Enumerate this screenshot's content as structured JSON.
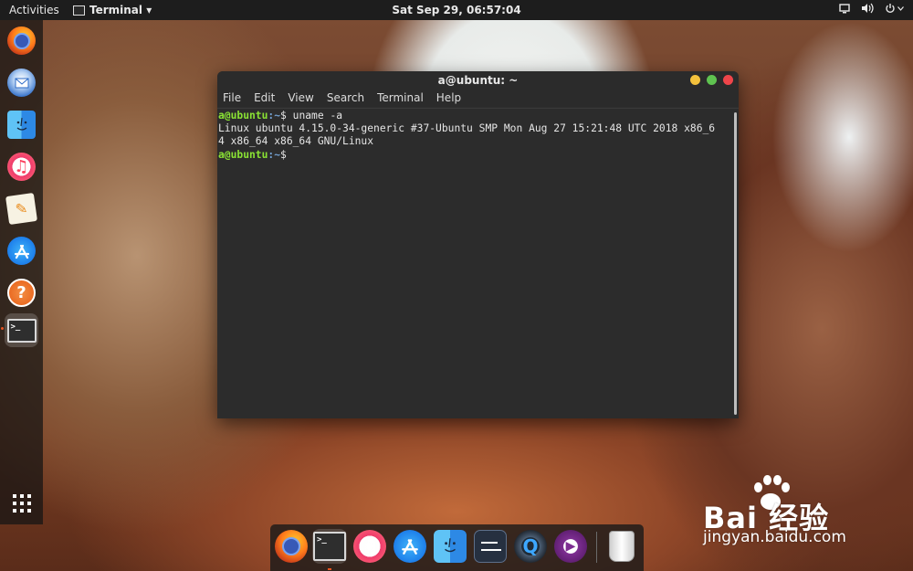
{
  "topbar": {
    "activities": "Activities",
    "app_menu": "Terminal ▾",
    "clock": "Sat Sep 29, 06:57:04",
    "tray": [
      "screen-icon",
      "volume-icon",
      "power-icon"
    ]
  },
  "dock": {
    "items": [
      {
        "name": "firefox-icon"
      },
      {
        "name": "thunderbird-icon"
      },
      {
        "name": "finder-icon"
      },
      {
        "name": "itunes-icon"
      },
      {
        "name": "pages-icon"
      },
      {
        "name": "app-store-icon"
      },
      {
        "name": "help-icon"
      },
      {
        "name": "terminal-icon",
        "active": true
      },
      {
        "name": "show-applications-icon"
      }
    ]
  },
  "window": {
    "title": "a@ubuntu: ~",
    "menu": [
      "File",
      "Edit",
      "View",
      "Search",
      "Terminal",
      "Help"
    ],
    "terminal": {
      "prompt_user": "a@ubuntu",
      "prompt_path": ":~",
      "prompt_symbol": "$",
      "command": " uname -a",
      "output_line1": "Linux ubuntu 4.15.0-34-generic #37-Ubuntu SMP Mon Aug 27 15:21:48 UTC 2018 x86_6",
      "output_line2": "4 x86_64 x86_64 GNU/Linux"
    }
  },
  "bottom_dock": {
    "items": [
      "firefox-icon",
      "terminal-icon",
      "itunes-icon",
      "app-store-icon",
      "finder-icon",
      "settings-icon",
      "quicktime-icon",
      "media-player-icon",
      "trash-icon"
    ]
  },
  "watermark": {
    "brand": "Bai  经验",
    "url": "jingyan.baidu.com"
  },
  "colors": {
    "topbar": "#1d1d1d",
    "terminal_bg": "#2c2c2c",
    "prompt_user": "#8ae234",
    "prompt_path": "#729fcf",
    "accent": "#e95420"
  }
}
